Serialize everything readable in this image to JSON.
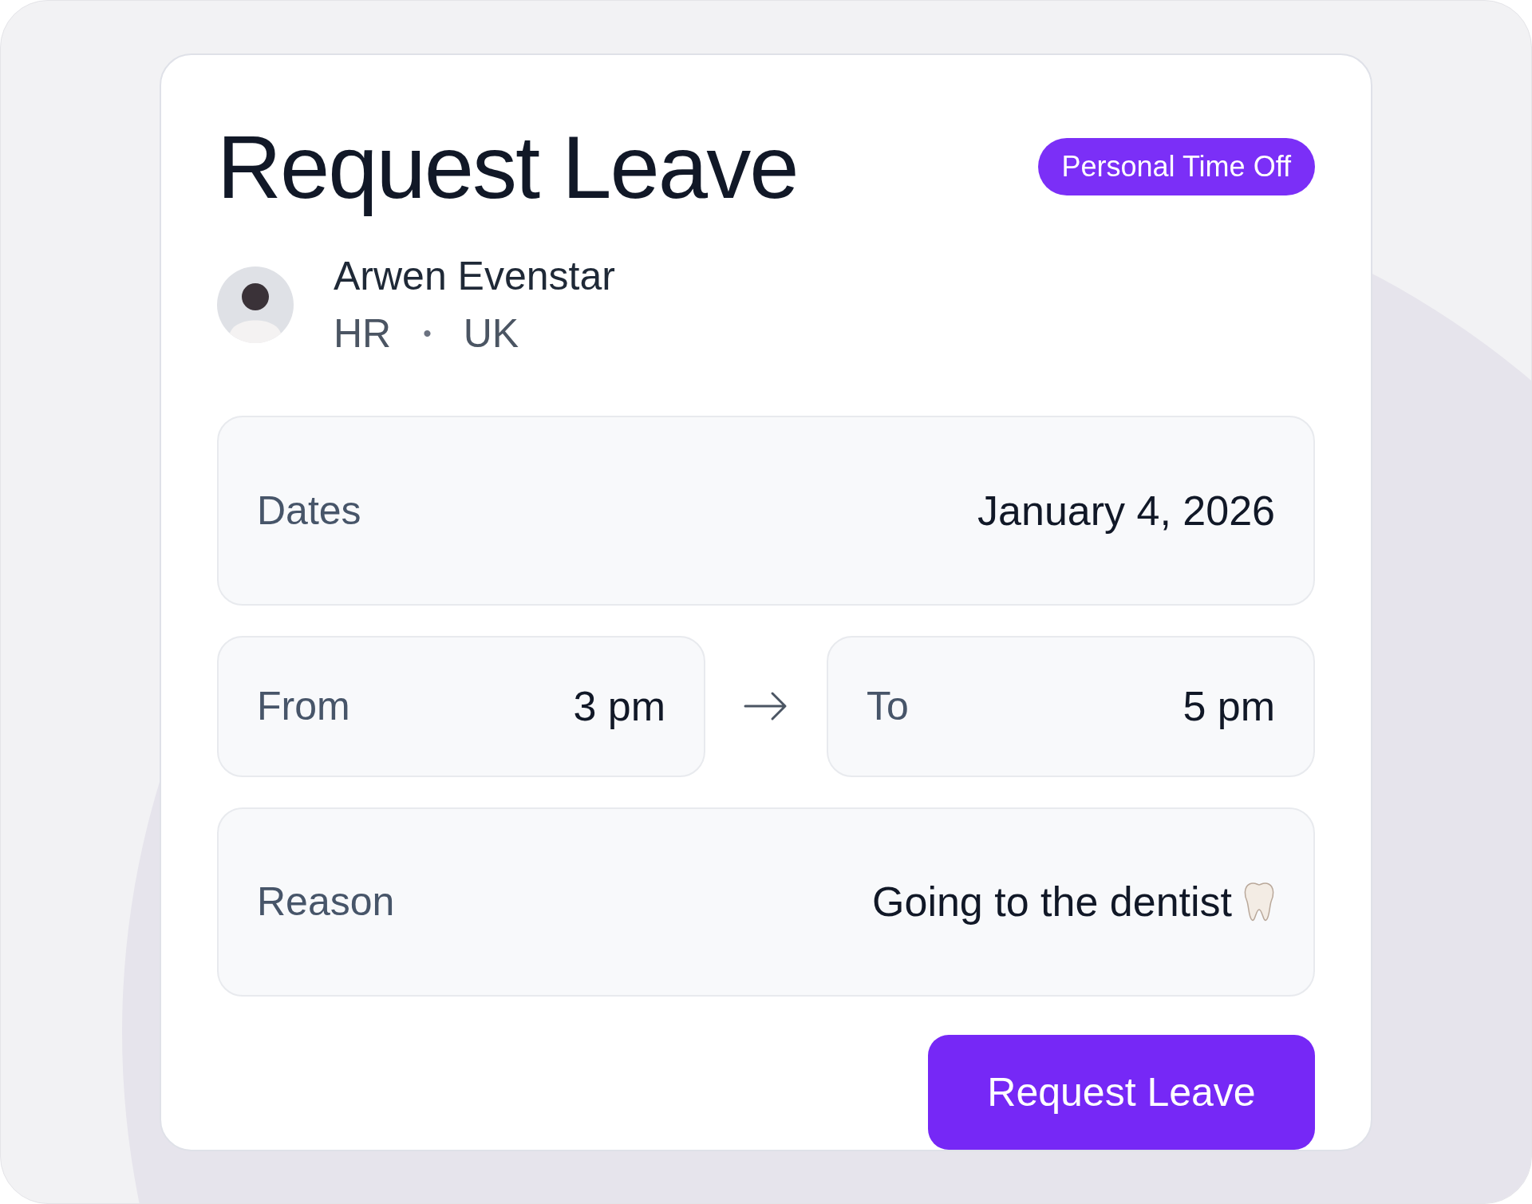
{
  "title": "Request Leave",
  "badge": "Personal Time Off",
  "employee": {
    "name": "Arwen Evenstar",
    "department": "HR",
    "separator": "•",
    "location": "UK"
  },
  "dates": {
    "label": "Dates",
    "value": "January 4, 2026"
  },
  "from": {
    "label": "From",
    "value": "3 pm"
  },
  "to": {
    "label": "To",
    "value": "5 pm"
  },
  "reason": {
    "label": "Reason",
    "value": "Going to the dentist"
  },
  "button": "Request Leave"
}
